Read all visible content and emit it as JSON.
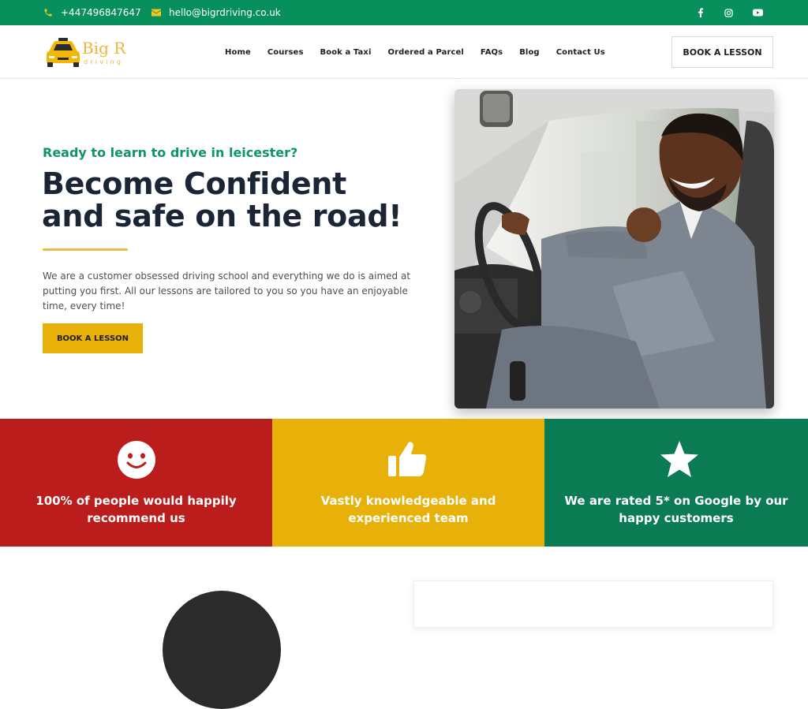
{
  "topbar": {
    "phone": "+447496847647",
    "email": "hello@bigrdriving.co.uk",
    "social": [
      "facebook-icon",
      "instagram-icon",
      "youtube-icon"
    ]
  },
  "logo": {
    "text_big": "Big R",
    "text_small": "driving"
  },
  "nav": {
    "items": [
      "Home",
      "Courses",
      "Book a Taxi",
      "Ordered a Parcel",
      "FAQs",
      "Blog",
      "Contact Us"
    ],
    "cta": "BOOK A LESSON"
  },
  "hero": {
    "kicker": "Ready to learn to drive in leicester?",
    "title_line1": "Become Confident",
    "title_line2": "and safe on the road!",
    "text": "We are a customer obsessed driving school and everything we do is aimed at putting you first. All our lessons are tailored to you so you have an enjoyable time, every time!",
    "button": "BOOK A LESSON"
  },
  "features": [
    {
      "icon": "smile-icon",
      "text": "100% of people would happily recommend us",
      "color": "#bb1c1c"
    },
    {
      "icon": "thumbs-up-icon",
      "text": "Vastly knowledgeable and experienced team",
      "color": "#e8b10a"
    },
    {
      "icon": "star-icon",
      "text": "We are rated 5* on Google by our happy customers",
      "color": "#0a7b53"
    }
  ],
  "colors": {
    "green": "#07905c",
    "yellow": "#e8b10a",
    "red": "#bb1c1c"
  }
}
